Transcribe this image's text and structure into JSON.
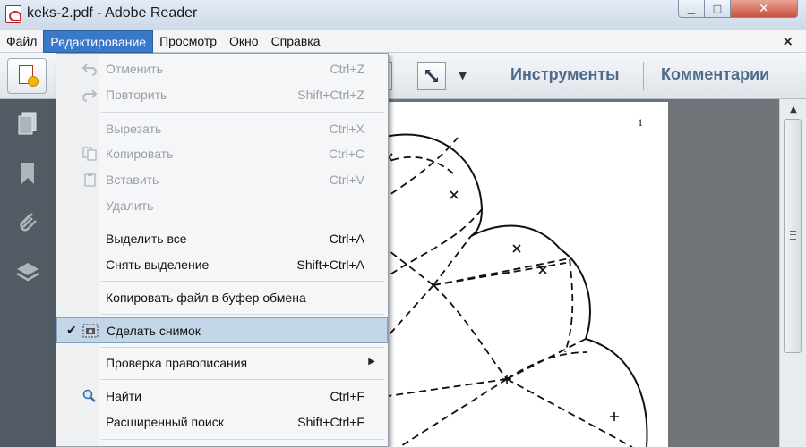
{
  "window": {
    "title": "keks-2.pdf - Adobe Reader"
  },
  "menubar": {
    "items": [
      "Файл",
      "Редактирование",
      "Просмотр",
      "Окно",
      "Справка"
    ],
    "close": "×"
  },
  "toolbar": {
    "tools_label": "Инструменты",
    "comments_label": "Комментарии",
    "dropdown_glyph": "▼"
  },
  "document": {
    "page_number": "1"
  },
  "edit_menu": {
    "undo": {
      "label": "Отменить",
      "shortcut": "Ctrl+Z"
    },
    "redo": {
      "label": "Повторить",
      "shortcut": "Shift+Ctrl+Z"
    },
    "cut": {
      "label": "Вырезать",
      "shortcut": "Ctrl+X"
    },
    "copy": {
      "label": "Копировать",
      "shortcut": "Ctrl+C"
    },
    "paste": {
      "label": "Вставить",
      "shortcut": "Ctrl+V"
    },
    "delete": {
      "label": "Удалить"
    },
    "select_all": {
      "label": "Выделить все",
      "shortcut": "Ctrl+A"
    },
    "deselect": {
      "label": "Снять выделение",
      "shortcut": "Shift+Ctrl+A"
    },
    "copy_file": {
      "label": "Копировать файл в буфер обмена"
    },
    "snapshot": {
      "label": "Сделать снимок",
      "checkmark": "✔"
    },
    "spellcheck": {
      "label": "Проверка правописания",
      "arrow": "▶"
    },
    "find": {
      "label": "Найти",
      "shortcut": "Ctrl+F"
    },
    "advanced_search": {
      "label": "Расширенный поиск",
      "shortcut": "Shift+Ctrl+F"
    }
  },
  "colors": {
    "menu_highlight": "#3a78c8",
    "checked_row": "#c3d6e8",
    "nav_pane": "#525a63"
  }
}
